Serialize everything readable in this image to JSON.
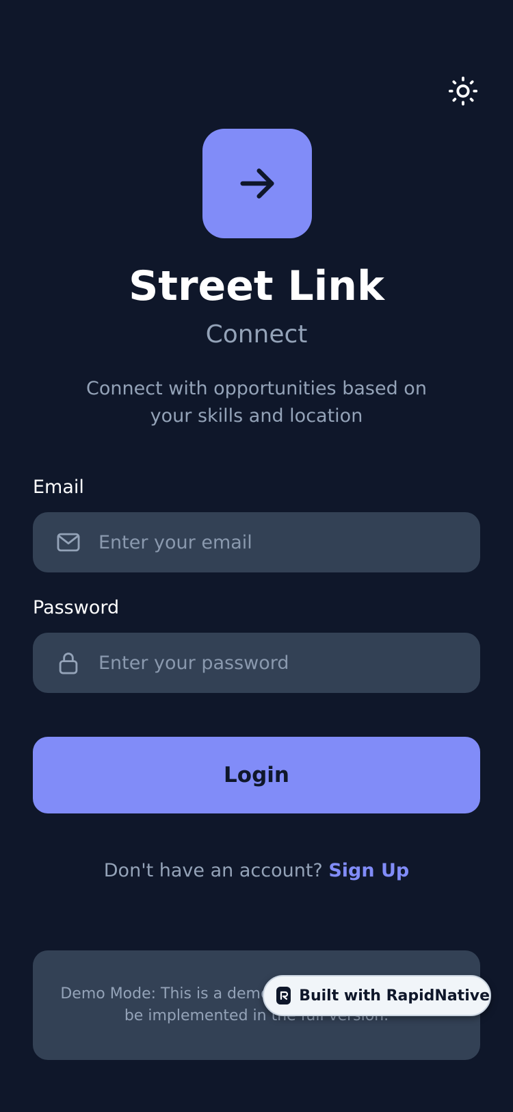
{
  "header": {
    "theme_toggle_icon": "sun-icon"
  },
  "brand": {
    "logo_icon": "arrow-right-icon",
    "title": "Street Link",
    "subtitle": "Connect",
    "tagline": "Connect with opportunities based on your skills and location"
  },
  "form": {
    "email": {
      "label": "Email",
      "placeholder": "Enter your email",
      "value": "",
      "icon": "mail-icon"
    },
    "password": {
      "label": "Password",
      "placeholder": "Enter your password",
      "value": "",
      "icon": "lock-icon"
    },
    "login_label": "Login"
  },
  "signup": {
    "prompt": "Don't have an account? ",
    "link_label": "Sign Up"
  },
  "demo": {
    "text": "Demo Mode: This is a demo app. Authentication will be implemented in the full version."
  },
  "badge": {
    "icon": "rapidnative-logo-icon",
    "label": "Built with RapidNative"
  },
  "colors": {
    "background": "#0f172a",
    "surface": "#334155",
    "accent": "#818cf8",
    "muted_text": "#94a3b8",
    "text": "#ffffff"
  }
}
